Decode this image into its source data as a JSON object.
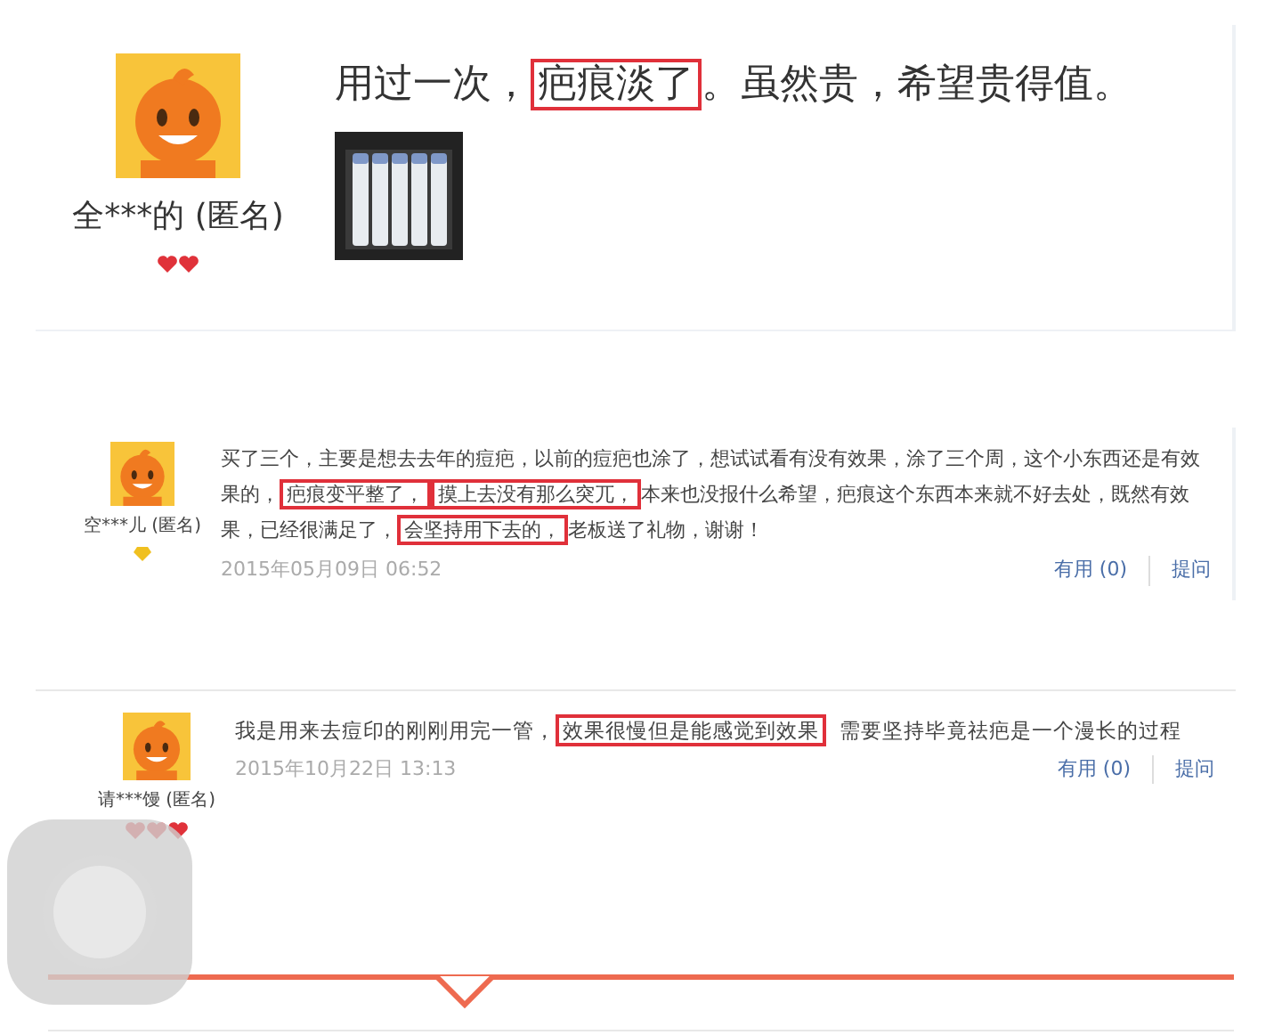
{
  "reviews": [
    {
      "kind": "large",
      "user": "全***的 (匿名)",
      "level_icons": [
        {
          "kind": "heart"
        },
        {
          "kind": "heart"
        }
      ],
      "segments": [
        {
          "text": "用过一次，",
          "highlighted": false
        },
        {
          "text": "疤痕淡了",
          "highlighted": true
        },
        {
          "text": "。虽然贵，希望贵得值。",
          "highlighted": false
        }
      ],
      "photos": [
        {
          "kind": "picture"
        }
      ]
    },
    {
      "kind": "small",
      "user": "空***儿 (匿名)",
      "level_icons": [
        {
          "kind": "diamond"
        }
      ],
      "segments": [
        {
          "text": "买了三个，主要是想去去年的痘疤，以前的痘疤也涂了，想试试看有没有效果，涂了三个周，这个小东西还是有效果的，",
          "highlighted": false
        },
        {
          "text": "疤痕变平整了，",
          "highlighted": true
        },
        {
          "text": "摸上去没有那么突兀，",
          "highlighted": true
        },
        {
          "text": "本来也没报什么希望，疤痕这个东西本来就不好去处，既然有效果，已经很满足了，",
          "highlighted": false
        },
        {
          "text": "会坚持用下去的，",
          "highlighted": true
        },
        {
          "text": "老板送了礼物，谢谢！",
          "highlighted": false
        }
      ],
      "date": "2015年05月09日 06:52",
      "useful": "有用 (0)",
      "ask": "提问"
    },
    {
      "kind": "medium",
      "user": "请***馒 (匿名)",
      "level_icons": [
        {
          "kind": "heart"
        },
        {
          "kind": "heart"
        },
        {
          "kind": "heart"
        }
      ],
      "segments": [
        {
          "text": "我是用来去痘印的刚刚用完一管，",
          "highlighted": false
        },
        {
          "text": "效果很慢但是能感觉到效果",
          "highlighted": true
        },
        {
          "text": "  需要坚持毕竟祛疤是一个漫长的过程",
          "highlighted": false
        }
      ],
      "date": "2015年10月22日 13:13",
      "useful": "有用 (0)",
      "ask": "提问"
    }
  ]
}
